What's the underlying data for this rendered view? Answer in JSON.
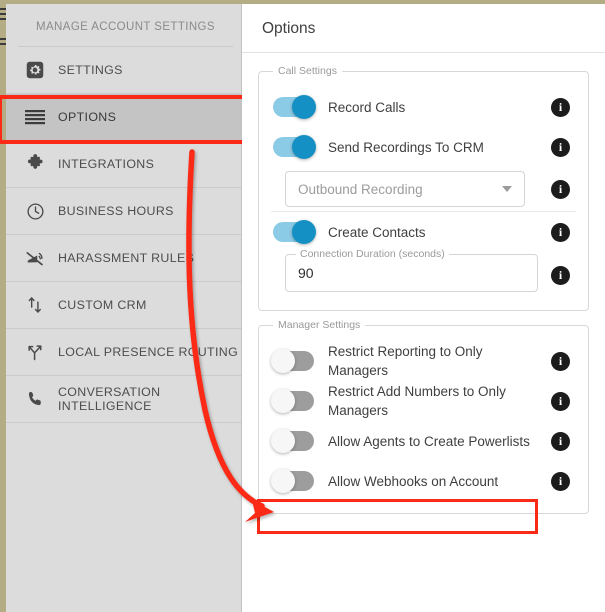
{
  "theme": {
    "top_border": "#b3ac84",
    "sidebar_bg": "#dcdcdc",
    "sidebar_active_bg": "#c4c4c4",
    "annotation_red": "#fa2a16",
    "toggle_on_track": "#8ccbe6",
    "toggle_on_thumb": "#1590c4",
    "toggle_off_track": "#9d9d9d",
    "toggle_off_thumb": "#f7f7f7",
    "info_icon_bg": "#1c1c1c"
  },
  "sidebar": {
    "title": "MANAGE ACCOUNT SETTINGS",
    "items": [
      {
        "label": "SETTINGS",
        "icon": "gear-icon",
        "active": false
      },
      {
        "label": "OPTIONS",
        "icon": "list-lines-icon",
        "active": true
      },
      {
        "label": "INTEGRATIONS",
        "icon": "puzzle-piece-icon",
        "active": false
      },
      {
        "label": "BUSINESS HOURS",
        "icon": "clock-icon",
        "active": false
      },
      {
        "label": "HARASSMENT RULES",
        "icon": "megaphone-muted-icon",
        "active": false
      },
      {
        "label": "CUSTOM CRM",
        "icon": "transfer-arrows-icon",
        "active": false
      },
      {
        "label": "LOCAL PRESENCE ROUTING",
        "icon": "branch-arrows-icon",
        "active": false
      },
      {
        "label": "CONVERSATION INTELLIGENCE",
        "icon": "phone-icon",
        "active": false
      }
    ]
  },
  "main": {
    "header_title": "Options",
    "groups": [
      {
        "legend": "Call Settings",
        "rows": [
          {
            "kind": "toggle",
            "label": "Record Calls",
            "state": "on",
            "info": "i"
          },
          {
            "kind": "toggle",
            "label": "Send Recordings To CRM",
            "state": "on",
            "info": "i"
          },
          {
            "kind": "select",
            "value": "Outbound Recording",
            "info": "i"
          },
          {
            "kind": "toggle",
            "label": "Create Contacts",
            "state": "on",
            "info": "i"
          },
          {
            "kind": "field",
            "label": "Connection Duration (seconds)",
            "value": "90",
            "info": "i"
          }
        ]
      },
      {
        "legend": "Manager Settings",
        "rows": [
          {
            "kind": "toggle",
            "label": "Restrict Reporting to Only Managers",
            "state": "off",
            "info": "i"
          },
          {
            "kind": "toggle",
            "label": "Restrict Add Numbers to Only Managers",
            "state": "off",
            "info": "i"
          },
          {
            "kind": "toggle",
            "label": "Allow Agents to Create Powerlists",
            "state": "off",
            "info": "i",
            "highlighted": true
          },
          {
            "kind": "toggle",
            "label": "Allow Webhooks on Account",
            "state": "off",
            "info": "i"
          }
        ]
      }
    ]
  },
  "annotations": {
    "options_highlight": "red-box-around-options-nav-item",
    "powerlist_highlight": "red-box-around-allow-agents-to-create-powerlists",
    "arrow": "red-curved-arrow-from-options-to-powerlists"
  }
}
